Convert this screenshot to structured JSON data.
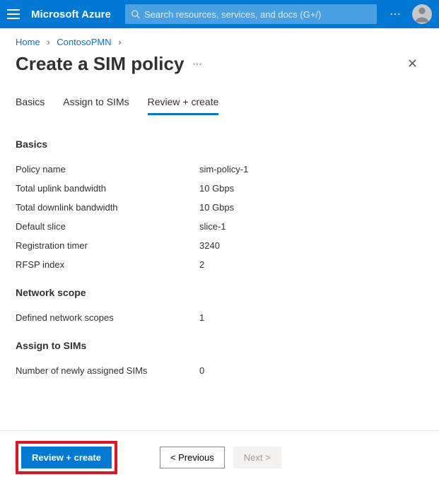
{
  "topbar": {
    "brand": "Microsoft Azure",
    "search_placeholder": "Search resources, services, and docs (G+/)"
  },
  "breadcrumb": {
    "home": "Home",
    "resource": "ContosoPMN"
  },
  "page": {
    "title": "Create a SIM policy"
  },
  "tabs": {
    "basics": "Basics",
    "assign": "Assign to SIMs",
    "review": "Review + create"
  },
  "sections": {
    "basics_title": "Basics",
    "network_title": "Network scope",
    "assign_title": "Assign to SIMs"
  },
  "fields": {
    "policy_name_label": "Policy name",
    "policy_name_value": "sim-policy-1",
    "uplink_label": "Total uplink bandwidth",
    "uplink_value": "10 Gbps",
    "downlink_label": "Total downlink bandwidth",
    "downlink_value": "10 Gbps",
    "slice_label": "Default slice",
    "slice_value": "slice-1",
    "reg_timer_label": "Registration timer",
    "reg_timer_value": "3240",
    "rfsp_label": "RFSP index",
    "rfsp_value": "2",
    "scopes_label": "Defined network scopes",
    "scopes_value": "1",
    "sims_label": "Number of newly assigned SIMs",
    "sims_value": "0"
  },
  "footer": {
    "review_create": "Review + create",
    "previous": "< Previous",
    "next": "Next >"
  }
}
